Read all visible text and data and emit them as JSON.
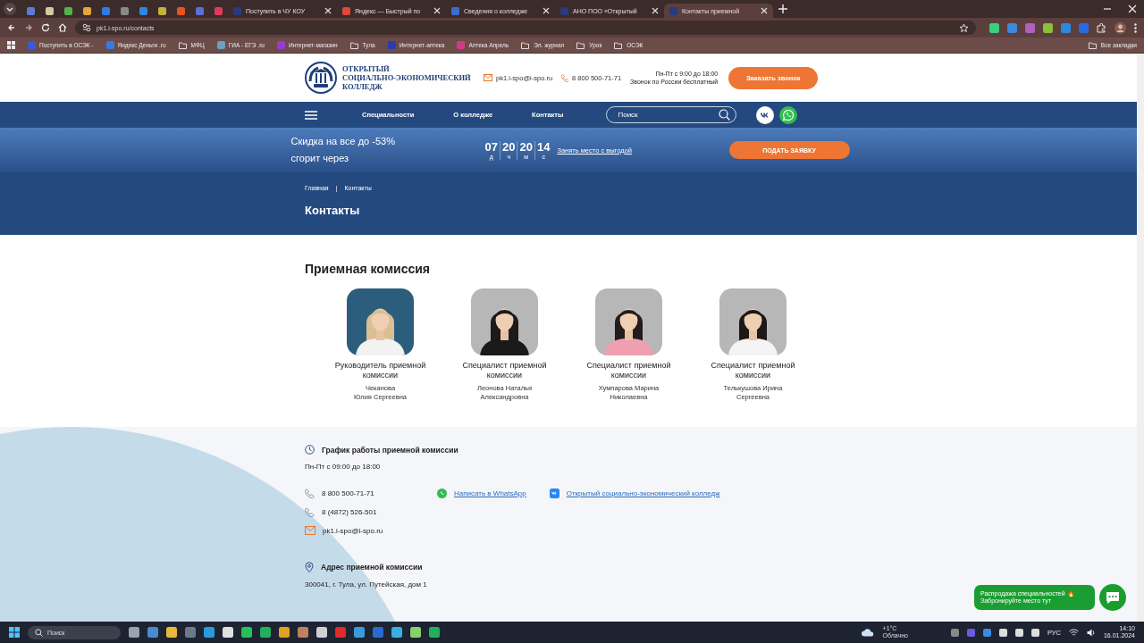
{
  "browser": {
    "tabs": [
      {
        "color": "#5b7bd5",
        "selected": false
      },
      {
        "color": "#d9c8a0",
        "selected": false
      },
      {
        "color": "#58b04b",
        "selected": false
      },
      {
        "color": "#e8a33a",
        "selected": false
      },
      {
        "color": "#2f7be6",
        "selected": false
      },
      {
        "color": "#8a8a8a",
        "selected": false
      },
      {
        "color": "#2f86e0",
        "selected": false
      },
      {
        "color": "#c5b23a",
        "selected": false
      },
      {
        "color": "#e8531f",
        "selected": false
      },
      {
        "color": "#5a6fd8",
        "selected": false
      },
      {
        "color": "#e03a5a",
        "selected": false
      },
      {
        "title": "Поступить в ЧУ КОУ",
        "color": "#2a3a80",
        "selected": false
      },
      {
        "title": "Яндекс — Быстрый по",
        "color": "#e0483a",
        "selected": false
      },
      {
        "title": "Сведения о колледже",
        "color": "#3a6fd0",
        "selected": false
      },
      {
        "title": "АНО ПОО «Открытый",
        "color": "#2a3a80",
        "selected": false
      },
      {
        "title": "Контакты приемной",
        "color": "#2a3a80",
        "selected": true
      }
    ],
    "address": "pk1.i-spo.ru/contacts",
    "bookmarks": [
      {
        "kind": "site",
        "label": "Поступить в ОСЭК -",
        "color": "#3a5ad8"
      },
      {
        "kind": "site",
        "label": "Яндекс Деньги .ru",
        "color": "#3a7ae0"
      },
      {
        "kind": "folder",
        "label": "МФЦ"
      },
      {
        "kind": "site",
        "label": "ГИА - ЕГЭ .ru",
        "color": "#6aa0c0"
      },
      {
        "kind": "site",
        "label": "Интернет-магазин",
        "color": "#9a3ad0"
      },
      {
        "kind": "folder",
        "label": "Тула"
      },
      {
        "kind": "site",
        "label": "Интернет-аптека",
        "color": "#2a3ab0"
      },
      {
        "kind": "site",
        "label": "Аптека Апрель",
        "color": "#d03a8a"
      },
      {
        "kind": "folder",
        "label": "Эл. журнал"
      },
      {
        "kind": "folder",
        "label": "Урок"
      },
      {
        "kind": "folder",
        "label": "ОСЭК"
      }
    ],
    "all_bookmarks": "Все закладки"
  },
  "header": {
    "logo": "ОТКРЫТЫЙ\nСОЦИАЛЬНО-ЭКОНОМИЧЕСКИЙ\nКОЛЛЕДЖ",
    "email": "pk1.i-spo@i-spo.ru",
    "phone": "8 800 500-71-71",
    "hours": "Пн-Пт с 9:00 до 18:00",
    "free_call": "Звонок по России бесплатный",
    "button": "Заказать звонок"
  },
  "nav": {
    "links": [
      "Специальности",
      "О колледже",
      "Контакты"
    ],
    "search": {
      "placeholder": "Поиск"
    }
  },
  "promo": {
    "text": "Скидка на все до -53%\nсгорит через",
    "countdown": [
      {
        "value": "07",
        "unit": "д"
      },
      {
        "value": "20",
        "unit": "ч"
      },
      {
        "value": "20",
        "unit": "м"
      },
      {
        "value": "14",
        "unit": "с"
      }
    ],
    "link": "Занять место с выгодой",
    "button": "ПОДАТЬ ЗАЯВКУ"
  },
  "breadcrumbs": {
    "items": [
      "Главная",
      "Контакты"
    ],
    "separator": "|"
  },
  "page_title": "Контакты",
  "committee": {
    "title": "Приемная комиссия",
    "people": [
      {
        "role": "Руководитель приемной комиссии",
        "name": "Чеканова\nЮлия Сергеевна"
      },
      {
        "role": "Специалист приемной комиссии",
        "name": "Леонова Наталья\nАлександровна"
      },
      {
        "role": "Специалист приемной комиссии",
        "name": "Хумпарова Марина\nНиколаевна"
      },
      {
        "role": "Специалист приемной комиссии",
        "name": "Телькушова Ирина\nСергеевна"
      }
    ]
  },
  "contacts": {
    "schedule_title": "График работы приемной комиссии",
    "schedule": "Пн-Пт с 09:00 до 18:00",
    "items": [
      {
        "kind": "phone",
        "text": "8 800 500-71-71"
      },
      {
        "kind": "phone",
        "text": "8 (4872) 526-501"
      },
      {
        "kind": "email",
        "text": "pk1.i-spo@i-spo.ru"
      }
    ],
    "links": [
      {
        "kind": "whatsapp",
        "text": "Написать в WhatsApp"
      },
      {
        "kind": "vk",
        "text": "Открытый социально-экономический колледж"
      }
    ],
    "address_title": "Адрес приемной комиссии",
    "address": "300041, г. Тула, ул. Путейская, дом 1"
  },
  "chat_popup": "Распродажа специальностей 🔥\nЗабронируйте место тут",
  "taskbar": {
    "search": "Поиск",
    "apps": [
      {
        "color": "#9aa3b0"
      },
      {
        "color": "#4a8ad0"
      },
      {
        "color": "#e8b83a"
      },
      {
        "color": "#6a7a8a"
      },
      {
        "color": "#2a9ae0"
      },
      {
        "color": "#e0e0e0"
      },
      {
        "color": "#25c05a"
      },
      {
        "color": "#20b060"
      },
      {
        "color": "#e0a020"
      },
      {
        "color": "#c08060"
      },
      {
        "color": "#d0d0d0"
      },
      {
        "color": "#e02a2a"
      },
      {
        "color": "#3a9ae0"
      },
      {
        "color": "#2a6ad0"
      },
      {
        "color": "#3ab0e0"
      },
      {
        "color": "#8ad06a"
      },
      {
        "color": "#20b060"
      }
    ],
    "weather_temp": "+1°C",
    "weather_text": "Облачно",
    "language": "РУС",
    "time": "14:10",
    "date": "16.01.2024"
  }
}
